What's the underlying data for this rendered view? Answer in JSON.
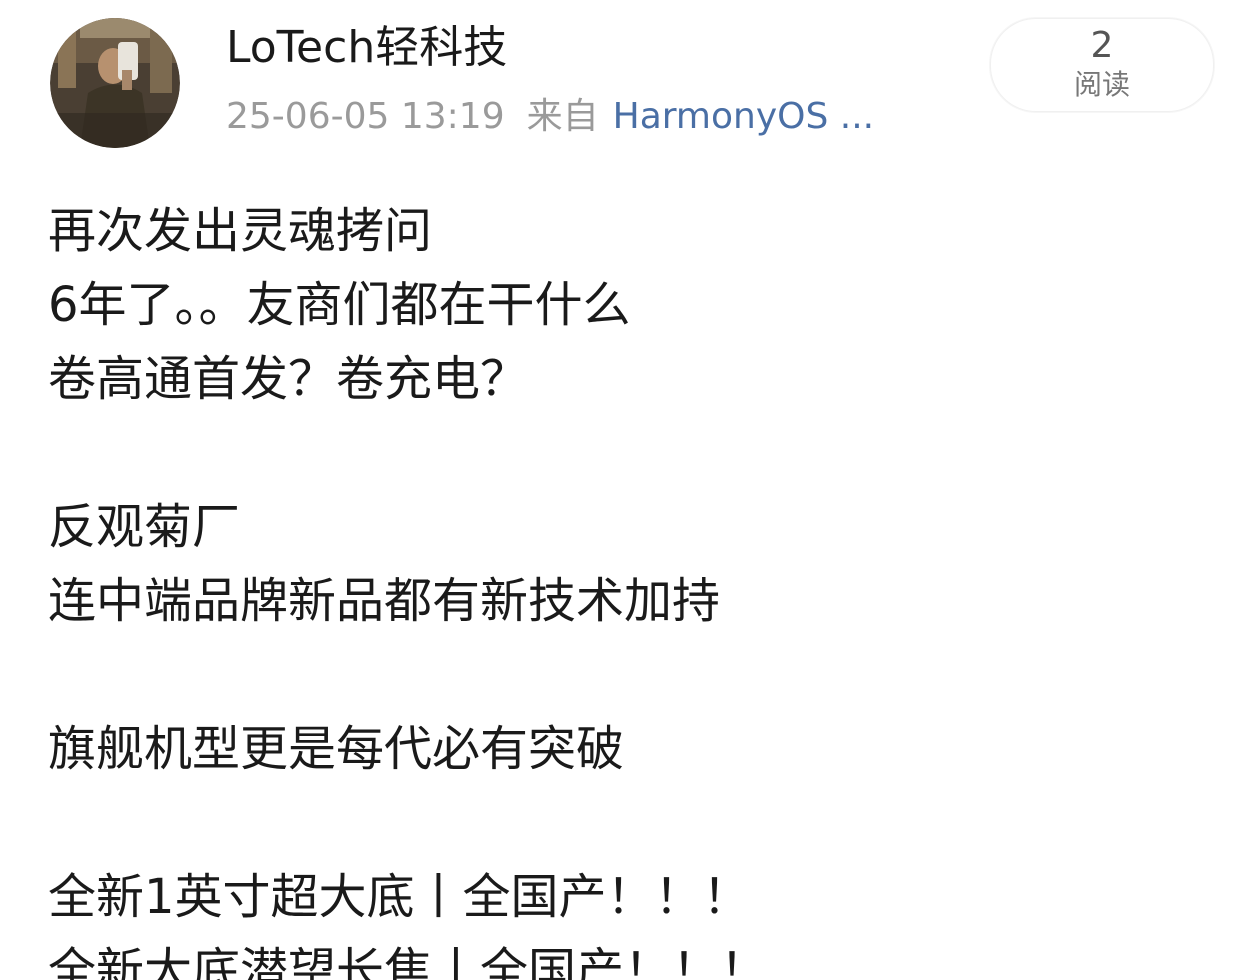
{
  "author": {
    "name": "LoTech轻科技",
    "avatar_icon": "avatar-photo-icon"
  },
  "meta": {
    "timestamp": "25-06-05 13:19",
    "from_label": "来自",
    "source": "HarmonyOS ..."
  },
  "reads": {
    "count": "2",
    "label": "阅读"
  },
  "post": {
    "lines": [
      "再次发出灵魂拷问",
      "6年了。。友商们都在干什么",
      "卷高通首发？卷充电？",
      "",
      "反观菊厂",
      "连中端品牌新品都有新技术加持",
      "",
      "旗舰机型更是每代必有突破",
      "",
      "全新1英寸超大底丨全国产！！！",
      "全新大底潜望长焦丨全国产！！！"
    ]
  },
  "colors": {
    "text": "#1a1a1a",
    "meta": "#9a9a9a",
    "link": "#4a6fa5"
  }
}
